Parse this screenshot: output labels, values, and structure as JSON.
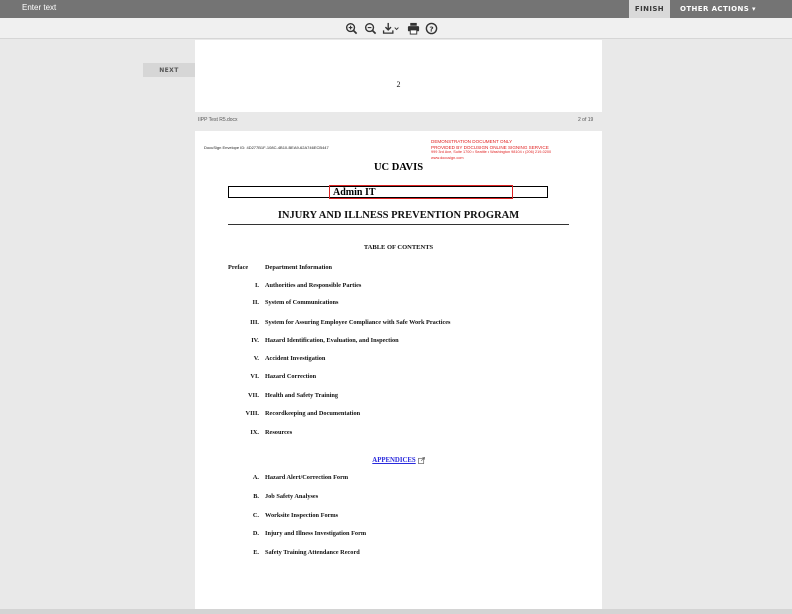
{
  "topbar": {
    "instruction": "Enter text",
    "finish_label": "FINISH",
    "other_actions_label": "OTHER ACTIONS ▾"
  },
  "toolbar": {
    "icons": [
      "zoom-in-icon",
      "zoom-out-icon",
      "download-icon",
      "print-icon",
      "help-icon"
    ]
  },
  "nav": {
    "next_label": "NEXT"
  },
  "page1": {
    "page_number": "2",
    "footer_filename": "IIPP Test R5.docx",
    "footer_page": "2 of 19"
  },
  "page2": {
    "envelope_id": "DocuSign Envelope ID: 4D277B1F-108C-4B10-BEA9-62A746ECB447",
    "demo_notice": {
      "line1": "DEMONSTRATION DOCUMENT ONLY",
      "line2": "PROVIDED BY DOCUSIGN ONLINE SIGNING SERVICE",
      "line3": "999 3rd Ave, Suite 1700  • Seattle • Washington 98104 • (206) 219-0200",
      "line4": "www.docusign.com"
    },
    "org": "UC DAVIS",
    "department_value": "Admin IT",
    "program_title": "INJURY AND ILLNESS PREVENTION PROGRAM",
    "toc_heading": "TABLE OF CONTENTS",
    "toc": [
      {
        "num": "Preface",
        "label": "Department Information"
      },
      {
        "num": "I.",
        "label": "Authorities and Responsible Parties"
      },
      {
        "num": "II.",
        "label": "System of Communications"
      },
      {
        "num": "III.",
        "label": "System for Assuring Employee Compliance with Safe Work Practices"
      },
      {
        "num": "IV.",
        "label": "Hazard Identification, Evaluation, and Inspection"
      },
      {
        "num": "V.",
        "label": "Accident Investigation"
      },
      {
        "num": "VI.",
        "label": "Hazard Correction"
      },
      {
        "num": "VII.",
        "label": "Health and Safety Training"
      },
      {
        "num": "VIII.",
        "label": "Recordkeeping and Documentation"
      },
      {
        "num": "IX.",
        "label": "Resources"
      }
    ],
    "appendices_label": "APPENDICES",
    "appendices": [
      {
        "num": "A.",
        "label": "Hazard Alert/Correction Form"
      },
      {
        "num": "B.",
        "label": "Job Safety Analyses"
      },
      {
        "num": "C.",
        "label": "Worksite Inspection Forms"
      },
      {
        "num": "D.",
        "label": "Injury and Illness Investigation Form"
      },
      {
        "num": "E.",
        "label": "Safety Training Attendance Record"
      }
    ]
  }
}
